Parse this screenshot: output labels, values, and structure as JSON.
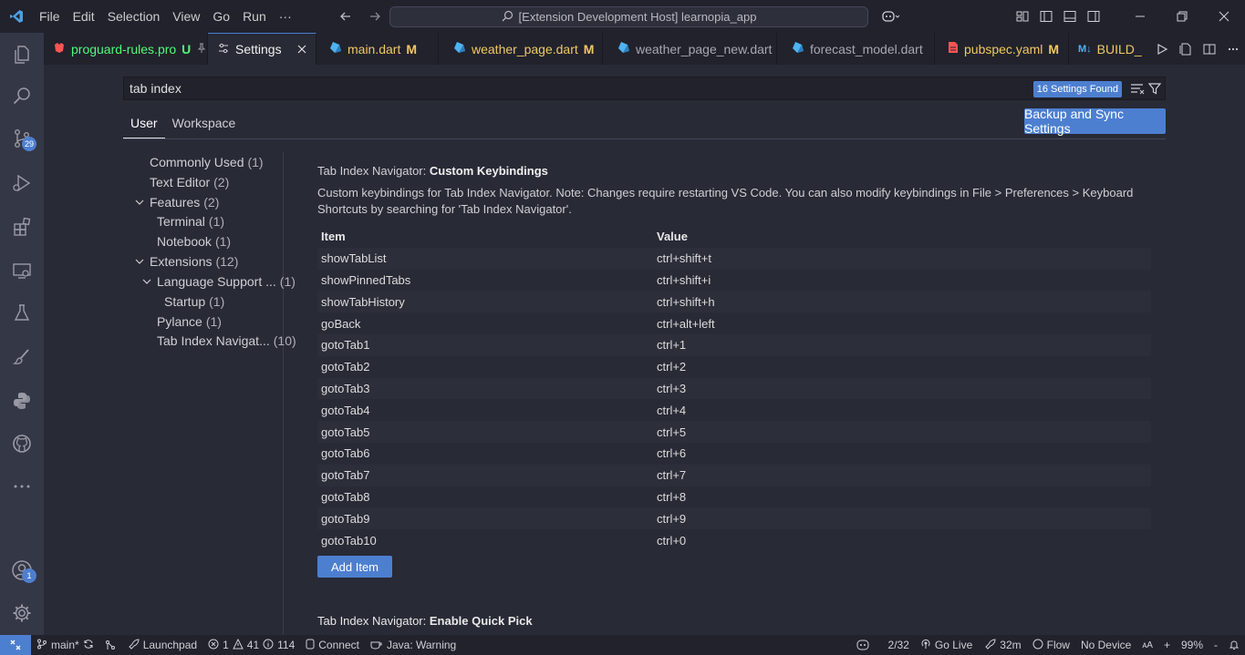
{
  "titlebar": {
    "menu": [
      "File",
      "Edit",
      "Selection",
      "View",
      "Go",
      "Run",
      "···"
    ],
    "command_center": "[Extension Development Host] learnopia_app"
  },
  "activity_bar": {
    "source_control_badge": "29",
    "accounts_badge": "1"
  },
  "tabs": [
    {
      "label": "proguard-rules.pro",
      "status": "U",
      "color": "#50fa7b",
      "icon_color": "#ff5555"
    },
    {
      "label": "Settings",
      "status": "",
      "color": "#f0f0f0"
    },
    {
      "label": "main.dart",
      "status": "M",
      "color": "#f1c863",
      "icon_color": "#4fb3f0"
    },
    {
      "label": "weather_page.dart",
      "status": "M",
      "color": "#f1c863",
      "icon_color": "#4fb3f0"
    },
    {
      "label": "weather_page_new.dart",
      "status": "",
      "color": "#a7a7b2",
      "icon_color": "#4fb3f0"
    },
    {
      "label": "forecast_model.dart",
      "status": "",
      "color": "#a7a7b2",
      "icon_color": "#4fb3f0"
    },
    {
      "label": "pubspec.yaml",
      "status": "M",
      "color": "#f1c863",
      "icon_color": "#ff5555"
    },
    {
      "label": "BUILD_",
      "status": "",
      "color": "#f1c863",
      "icon_color": "#4fb3f0"
    }
  ],
  "settings": {
    "search_value": "tab index",
    "found_badge": "16 Settings Found",
    "scope_tabs": [
      "User",
      "Workspace"
    ],
    "sync_button": "Backup and Sync Settings",
    "toc": [
      {
        "label": "Commonly Used",
        "count": "(1)"
      },
      {
        "label": "Text Editor",
        "count": "(2)"
      },
      {
        "label": "Features",
        "count": "(2)"
      },
      {
        "label": "Terminal",
        "count": "(1)"
      },
      {
        "label": "Notebook",
        "count": "(1)"
      },
      {
        "label": "Extensions",
        "count": "(12)"
      },
      {
        "label": "Language Support ...",
        "count": "(1)"
      },
      {
        "label": "Startup",
        "count": "(1)"
      },
      {
        "label": "Pylance",
        "count": "(1)"
      },
      {
        "label": "Tab Index Navigat...",
        "count": "(10)"
      }
    ],
    "setting1": {
      "category": "Tab Index Navigator: ",
      "name": "Custom Keybindings",
      "description": "Custom keybindings for Tab Index Navigator. Note: Changes require restarting VS Code. You can also modify keybindings in File > Preferences > Keyboard Shortcuts by searching for 'Tab Index Navigator'.",
      "col_item": "Item",
      "col_value": "Value",
      "rows": [
        {
          "k": "showTabList",
          "v": "ctrl+shift+t"
        },
        {
          "k": "showPinnedTabs",
          "v": "ctrl+shift+i"
        },
        {
          "k": "showTabHistory",
          "v": "ctrl+shift+h"
        },
        {
          "k": "goBack",
          "v": "ctrl+alt+left"
        },
        {
          "k": "gotoTab1",
          "v": "ctrl+1"
        },
        {
          "k": "gotoTab2",
          "v": "ctrl+2"
        },
        {
          "k": "gotoTab3",
          "v": "ctrl+3"
        },
        {
          "k": "gotoTab4",
          "v": "ctrl+4"
        },
        {
          "k": "gotoTab5",
          "v": "ctrl+5"
        },
        {
          "k": "gotoTab6",
          "v": "ctrl+6"
        },
        {
          "k": "gotoTab7",
          "v": "ctrl+7"
        },
        {
          "k": "gotoTab8",
          "v": "ctrl+8"
        },
        {
          "k": "gotoTab9",
          "v": "ctrl+9"
        },
        {
          "k": "gotoTab10",
          "v": "ctrl+0"
        }
      ],
      "add_button": "Add Item"
    },
    "setting2": {
      "category": "Tab Index Navigator: ",
      "name": "Enable Quick Pick"
    }
  },
  "statusbar": {
    "branch": "main*",
    "launchpad": "Launchpad",
    "errors": "1",
    "warnings": "41",
    "infos": "114",
    "connect": "Connect",
    "java": "Java: Warning",
    "position": "2/32",
    "go_live": "Go Live",
    "time": "32m",
    "flow": "Flow",
    "device": "No Device",
    "zoom": "99%"
  }
}
